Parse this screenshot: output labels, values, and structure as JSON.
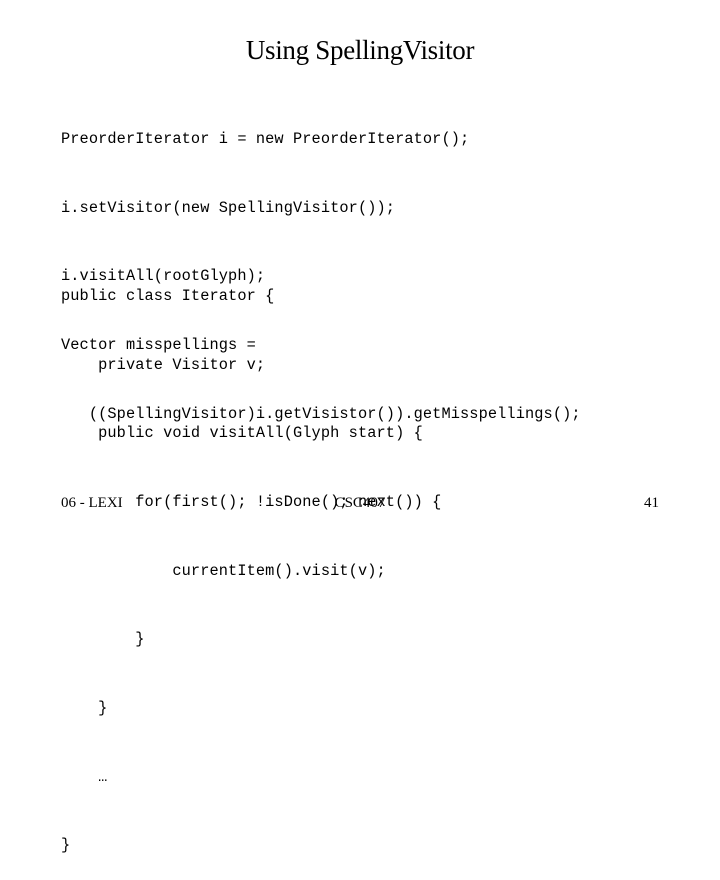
{
  "slide": {
    "title": "Using SpellingVisitor",
    "code_top": [
      "PreorderIterator i = new PreorderIterator();",
      "i.setVisitor(new SpellingVisitor());",
      "i.visitAll(rootGlyph);",
      "Vector misspellings =",
      "   ((SpellingVisitor)i.getVisistor()).getMisspellings();"
    ],
    "code_bottom": [
      "public class Iterator {",
      "    private Visitor v;",
      "    public void visitAll(Glyph start) {",
      "        for(first(); !isDone(); next()) {",
      "            currentItem().visit(v);",
      "        }",
      "    }",
      "    …",
      "}"
    ]
  },
  "footer": {
    "left": "06 - LEXI",
    "center": "CSC407",
    "page_number": "41"
  }
}
